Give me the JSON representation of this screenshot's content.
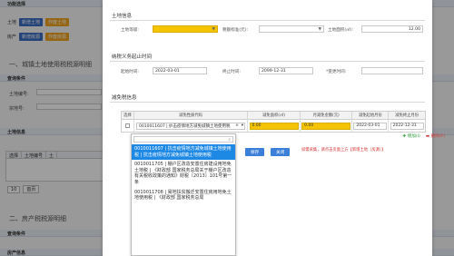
{
  "background": {
    "func_section": "功能选择",
    "func_rows": [
      {
        "label": "土地",
        "buttons": [
          "新增土地",
          "作废土地"
        ]
      },
      {
        "label": "房产",
        "buttons": [
          "新增房源",
          "作废房源"
        ]
      }
    ],
    "section1_title": "一、城镇土地使用税税源明细",
    "query_strip": "查询条件",
    "query_labels": [
      "土地编号:",
      "宗地号:"
    ],
    "land_info_strip": "土地信息",
    "table_cols": [
      "选择",
      "土地编号",
      "土"
    ],
    "pager": [
      "10",
      "首页"
    ],
    "section2_title": "二、房产税税源明细",
    "query_strip2": "查询条件",
    "property_strip": "房产信息"
  },
  "modal": {
    "land_info_title": "土地信息",
    "land_grade_label": "土地等级:",
    "land_grade_value": "",
    "tax_standard_label": "税额标准(元):",
    "taxable_area_label": "土地面积(㎡):",
    "taxable_area_value": "12.00",
    "period_title": "纳税义务起止时间",
    "start_label": "起始时间:",
    "start_value": "2022-03-01",
    "end_label": "终止时间:",
    "end_value": "2099-12-31",
    "change_label": "*变更时间:",
    "change_value": "",
    "reduction_title": "减免税信息",
    "table_headers": [
      "选择",
      "减免性质代码",
      "减免面积(㎡)",
      "月减免金额(元)",
      "减免起始月份",
      "减免终止月份"
    ],
    "table_row": {
      "code": "0010011607 | 扒击疫情地方减免城镇土地使用税",
      "area": "0.00",
      "amount": "0.00",
      "start": "2022-03-01",
      "end": "2022-12-31"
    },
    "add_label": "增加(I)",
    "delete_label": "删除(F)",
    "notice": "如需采集，请点击页面上方【新增土地（房源）】",
    "save_label": "保存",
    "close_label": "关闭"
  },
  "dropdown": {
    "items": [
      "0010011607 | 抗击疫情地方减免城镇土地使用税 | 抗击疫情地方减免城镇土地使用税",
      "0010011705 | 棚户区改造安置住房建设用地免土地税 | 《财政部 国家税务总局关于棚户区改造有关税收政策的通知》财税〔2013〕101号第一条",
      "0010011708 | 易地扶贫搬迁安置住房用地免土地使用税 | 《财政部 国家税务总局"
    ],
    "selected_index": 0
  },
  "colors": {
    "accent": "#1e88e5",
    "highlight": "#f5c400",
    "warning": "#d23131"
  }
}
